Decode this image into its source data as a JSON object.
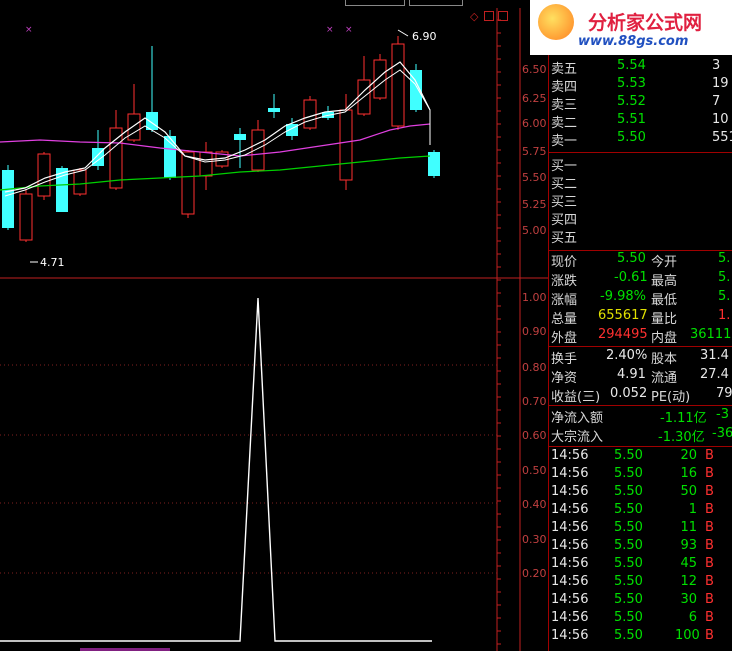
{
  "header": {
    "logo_text": "分析家公式网",
    "logo_url": "www.88gs.com",
    "price_label": "6.90",
    "low_label": "4.71"
  },
  "colors": {
    "background": "#000000",
    "up_candle": "#ff3030",
    "down_candle": "#40ffff",
    "ma_white": "#ffffff",
    "ma_magenta": "#e040e0",
    "ma_green": "#00d000",
    "axis": "#c02020"
  },
  "price_axis": [
    "6.50",
    "6.25",
    "6.00",
    "5.75",
    "5.50",
    "5.25",
    "5.00"
  ],
  "indicator_axis": [
    "1.00",
    "0.90",
    "0.80",
    "0.70",
    "0.60",
    "0.50",
    "0.40",
    "0.30",
    "0.20"
  ],
  "order_book": {
    "sell": [
      {
        "label": "卖五",
        "price": "5.54",
        "vol": "3"
      },
      {
        "label": "卖四",
        "price": "5.53",
        "vol": "19"
      },
      {
        "label": "卖三",
        "price": "5.52",
        "vol": "7"
      },
      {
        "label": "卖二",
        "price": "5.51",
        "vol": "10"
      },
      {
        "label": "卖一",
        "price": "5.50",
        "vol": "551"
      }
    ],
    "buy": [
      {
        "label": "买一"
      },
      {
        "label": "买二"
      },
      {
        "label": "买三"
      },
      {
        "label": "买四"
      },
      {
        "label": "买五"
      }
    ]
  },
  "quote": {
    "current_label": "现价",
    "current": "5.50",
    "open_label": "今开",
    "open": "5.",
    "change_label": "涨跌",
    "change": "-0.61",
    "high_label": "最高",
    "high": "5.",
    "pct_label": "涨幅",
    "pct": "-9.98%",
    "low_label": "最低",
    "low": "5.",
    "volume_label": "总量",
    "volume": "655617",
    "ratio_label": "量比",
    "ratio": "1.",
    "outer_label": "外盘",
    "outer": "294495",
    "inner_label": "内盘",
    "inner": "36111"
  },
  "fundamentals": {
    "turnover_label": "换手",
    "turnover": "2.40%",
    "shares_label": "股本",
    "shares": "31.4",
    "nav_label": "净资",
    "nav": "4.91",
    "float_label": "流通",
    "float": "27.4",
    "eps_label": "收益(三)",
    "eps": "0.052",
    "pe_label": "PE(动)",
    "pe": "79"
  },
  "flow": {
    "net_label": "净流入额",
    "net": "-1.11亿",
    "net2": "-3",
    "block_label": "大宗流入",
    "block": "-1.30亿",
    "block2": "-36"
  },
  "ticks": [
    {
      "time": "14:56",
      "price": "5.50",
      "vol": "20",
      "side": "B"
    },
    {
      "time": "14:56",
      "price": "5.50",
      "vol": "16",
      "side": "B"
    },
    {
      "time": "14:56",
      "price": "5.50",
      "vol": "50",
      "side": "B"
    },
    {
      "time": "14:56",
      "price": "5.50",
      "vol": "1",
      "side": "B"
    },
    {
      "time": "14:56",
      "price": "5.50",
      "vol": "11",
      "side": "B"
    },
    {
      "time": "14:56",
      "price": "5.50",
      "vol": "93",
      "side": "B"
    },
    {
      "time": "14:56",
      "price": "5.50",
      "vol": "45",
      "side": "B"
    },
    {
      "time": "14:56",
      "price": "5.50",
      "vol": "12",
      "side": "B"
    },
    {
      "time": "14:56",
      "price": "5.50",
      "vol": "30",
      "side": "B"
    },
    {
      "time": "14:56",
      "price": "5.50",
      "vol": "6",
      "side": "B"
    },
    {
      "time": "14:56",
      "price": "5.50",
      "vol": "100",
      "side": "B"
    }
  ]
}
